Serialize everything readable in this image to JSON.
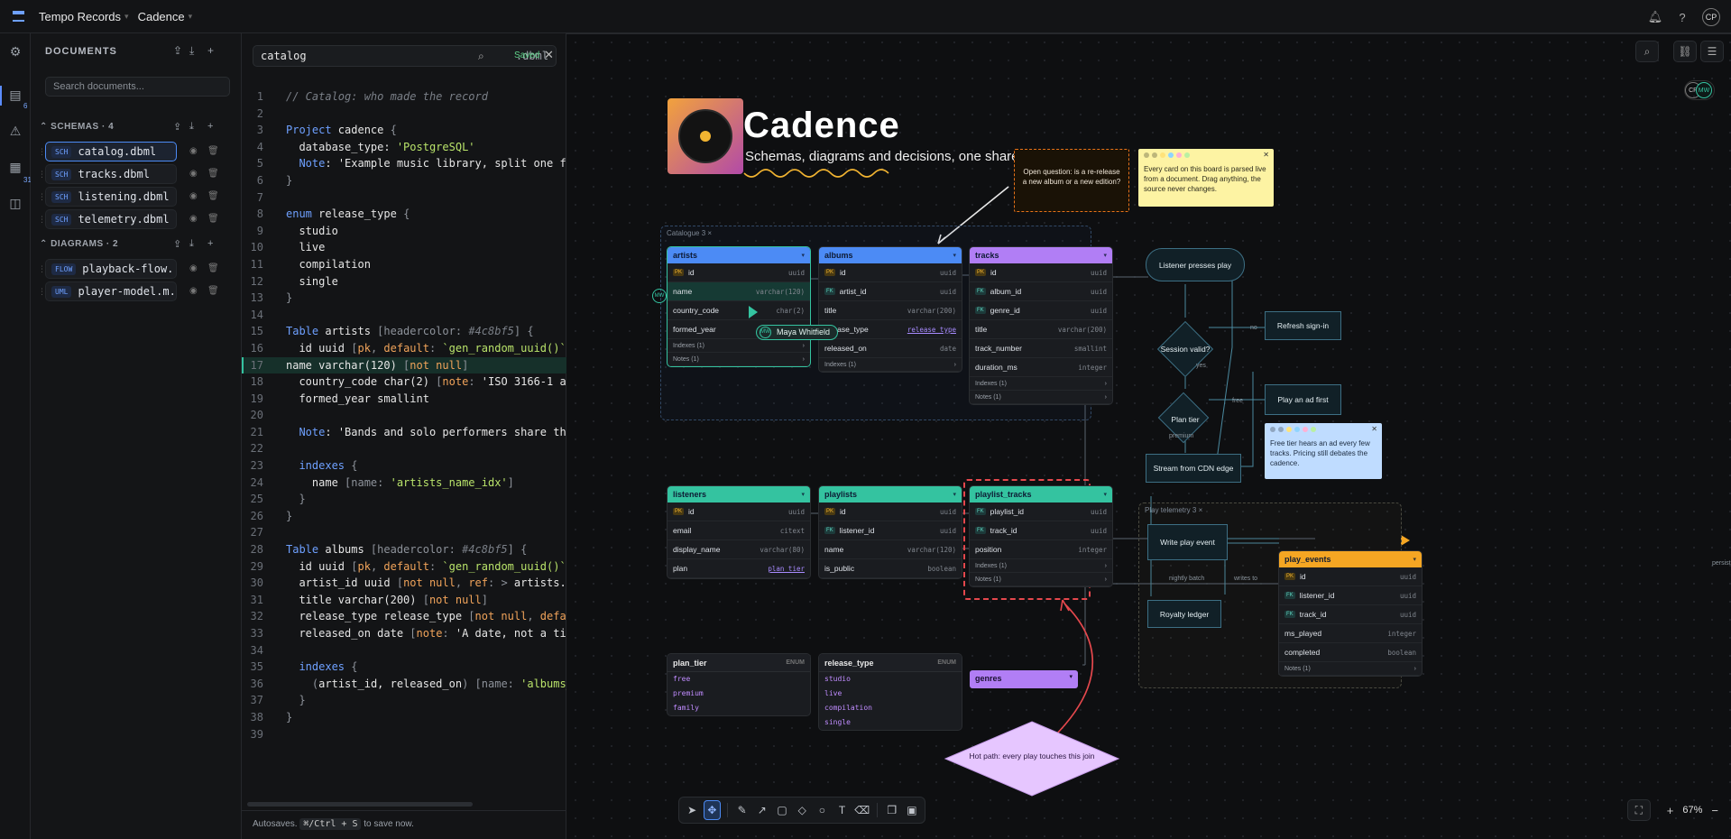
{
  "topbar": {
    "workspace": "Tempo Records",
    "project": "Cadence",
    "avatar": "CP"
  },
  "rail": {
    "docs_badge": "6",
    "library_badge": "31"
  },
  "documents": {
    "title": "DOCUMENTS",
    "search_placeholder": "Search documents...",
    "schemas_label": "SCHEMAS · 4",
    "diagrams_label": "DIAGRAMS · 2",
    "schemas": [
      {
        "tag": "SCH",
        "name": "catalog.dbml"
      },
      {
        "tag": "SCH",
        "name": "tracks.dbml"
      },
      {
        "tag": "SCH",
        "name": "listening.dbml"
      },
      {
        "tag": "SCH",
        "name": "telemetry.dbml"
      }
    ],
    "diagrams": [
      {
        "tag": "FLOW",
        "name": "playback-flow..."
      },
      {
        "tag": "UML",
        "name": "player-model.m..."
      }
    ]
  },
  "editor": {
    "filename": "catalog",
    "extension": ".dbml",
    "status": "Saved",
    "footer_text": "Autosaves.",
    "footer_kbd": "⌘/Ctrl + S",
    "footer_suffix": "to save now.",
    "lines": [
      "1",
      "2",
      "3",
      "4",
      "5",
      "6",
      "7",
      "8",
      "9",
      "10",
      "11",
      "12",
      "13",
      "14",
      "15",
      "16",
      "17",
      "18",
      "19",
      "20",
      "21",
      "22",
      "23",
      "24",
      "25",
      "26",
      "27",
      "28",
      "29",
      "30",
      "31",
      "32",
      "33",
      "34",
      "35",
      "36",
      "37",
      "38",
      "39"
    ]
  },
  "canvas": {
    "presence": [
      "CP",
      "MW"
    ],
    "title": "Cadence",
    "subtitle": "Schemas, diagrams and decisions, one shared board",
    "catalogue_frame": "Catalogue  3  ×",
    "telemetry_frame": "Play telemetry  3  ×",
    "cursor_user": "Maya Whitfield",
    "cursor_initials": "MW",
    "question_note": "Open question: is a re-release a new album or a new edition?",
    "yellow_note": "Every card on this board is parsed live from a document. Drag anything, the source never changes.",
    "blue_note": "Free tier hears an ad every few tracks. Pricing still debates the cadence.",
    "hot_path": "Hot path: every play touches this join",
    "tables": {
      "artists": {
        "name": "artists",
        "cols": [
          {
            "k": "PK",
            "n": "id",
            "t": "uuid"
          },
          {
            "k": "",
            "n": "name",
            "t": "varchar(120)"
          },
          {
            "k": "",
            "n": "country_code",
            "t": "char(2)"
          },
          {
            "k": "",
            "n": "formed_year",
            "t": "smallint"
          }
        ],
        "indexes": "Indexes (1)",
        "notes": "Notes (1)"
      },
      "albums": {
        "name": "albums",
        "cols": [
          {
            "k": "PK",
            "n": "id",
            "t": "uuid"
          },
          {
            "k": "FK",
            "n": "artist_id",
            "t": "uuid"
          },
          {
            "k": "",
            "n": "title",
            "t": "varchar(200)"
          },
          {
            "k": "",
            "n": "release_type",
            "t": "release_type"
          },
          {
            "k": "",
            "n": "released_on",
            "t": "date"
          }
        ],
        "indexes": "Indexes (1)"
      },
      "tracks": {
        "name": "tracks",
        "cols": [
          {
            "k": "PK",
            "n": "id",
            "t": "uuid"
          },
          {
            "k": "FK",
            "n": "album_id",
            "t": "uuid"
          },
          {
            "k": "FK",
            "n": "genre_id",
            "t": "uuid"
          },
          {
            "k": "",
            "n": "title",
            "t": "varchar(200)"
          },
          {
            "k": "",
            "n": "track_number",
            "t": "smallint"
          },
          {
            "k": "",
            "n": "duration_ms",
            "t": "integer"
          }
        ],
        "indexes": "Indexes (1)",
        "notes": "Notes (1)"
      },
      "listeners": {
        "name": "listeners",
        "cols": [
          {
            "k": "PK",
            "n": "id",
            "t": "uuid"
          },
          {
            "k": "",
            "n": "email",
            "t": "citext"
          },
          {
            "k": "",
            "n": "display_name",
            "t": "varchar(80)"
          },
          {
            "k": "",
            "n": "plan",
            "t": "plan_tier"
          }
        ]
      },
      "playlists": {
        "name": "playlists",
        "cols": [
          {
            "k": "PK",
            "n": "id",
            "t": "uuid"
          },
          {
            "k": "FK",
            "n": "listener_id",
            "t": "uuid"
          },
          {
            "k": "",
            "n": "name",
            "t": "varchar(120)"
          },
          {
            "k": "",
            "n": "is_public",
            "t": "boolean"
          }
        ]
      },
      "playlist_tracks": {
        "name": "playlist_tracks",
        "cols": [
          {
            "k": "FK",
            "n": "playlist_id",
            "t": "uuid"
          },
          {
            "k": "FK",
            "n": "track_id",
            "t": "uuid"
          },
          {
            "k": "",
            "n": "position",
            "t": "integer"
          }
        ],
        "indexes": "Indexes (1)",
        "notes": "Notes (1)"
      },
      "play_events": {
        "name": "play_events",
        "cols": [
          {
            "k": "PK",
            "n": "id",
            "t": "uuid"
          },
          {
            "k": "FK",
            "n": "listener_id",
            "t": "uuid"
          },
          {
            "k": "FK",
            "n": "track_id",
            "t": "uuid"
          },
          {
            "k": "",
            "n": "ms_played",
            "t": "integer"
          },
          {
            "k": "",
            "n": "completed",
            "t": "boolean"
          }
        ],
        "notes": "Notes (1)"
      }
    },
    "enums": {
      "plan_tier": {
        "name": "plan_tier",
        "tag": "ENUM",
        "values": [
          "free",
          "premium",
          "family"
        ]
      },
      "release_type": {
        "name": "release_type",
        "tag": "ENUM",
        "values": [
          "studio",
          "live",
          "compilation",
          "single"
        ]
      }
    },
    "genres": "genres",
    "flow": {
      "start": "Listener presses play",
      "session": "Session valid?",
      "refresh": "Refresh sign-in",
      "plan": "Plan tier",
      "ad": "Play an ad first",
      "stream": "Stream from CDN edge",
      "write": "Write play event",
      "ledger": "Royalty ledger",
      "no": "no",
      "yes": "yes",
      "free": "free",
      "premium": "premium",
      "nightly": "nightly batch",
      "writes_to": "writes to",
      "persists": "persists"
    },
    "zoom": "67%"
  },
  "colors": {
    "accent": "#4c8bf5",
    "teal": "#34c3a0",
    "purple": "#b18cff",
    "orange": "#f5a623",
    "danger": "#e5484d"
  }
}
